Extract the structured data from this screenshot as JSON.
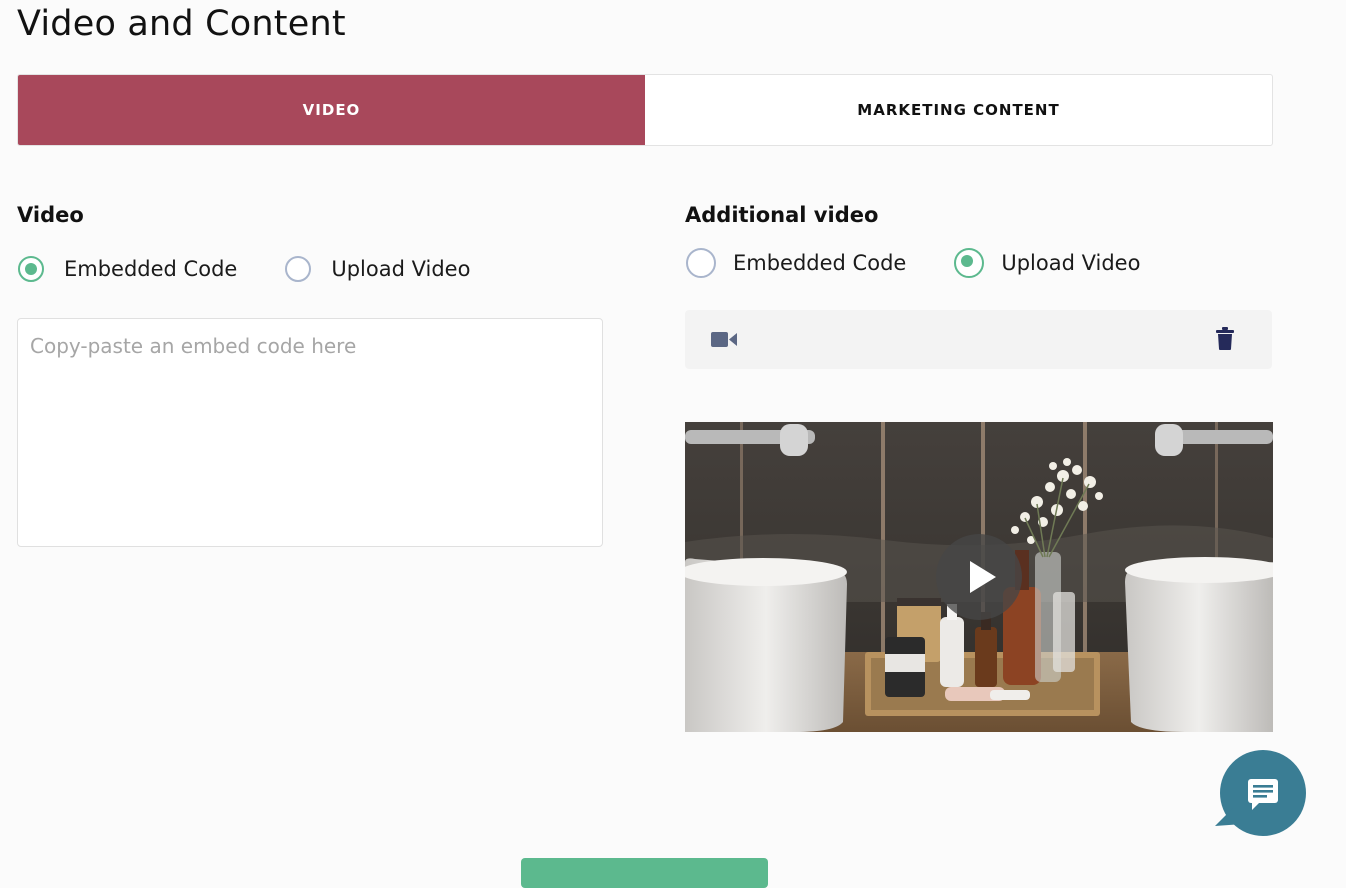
{
  "page": {
    "title": "Video and Content"
  },
  "tabs": [
    {
      "label": "VIDEO",
      "active": true
    },
    {
      "label": "MARKETING CONTENT",
      "active": false
    }
  ],
  "video_section": {
    "title": "Video",
    "options": [
      {
        "label": "Embedded Code",
        "checked": true
      },
      {
        "label": "Upload Video",
        "checked": false
      }
    ],
    "embed_placeholder": "Copy-paste an embed code here",
    "embed_value": ""
  },
  "additional_video_section": {
    "title": "Additional video",
    "options": [
      {
        "label": "Embedded Code",
        "checked": false
      },
      {
        "label": "Upload Video",
        "checked": true
      }
    ],
    "file_icon": "video-camera-icon",
    "delete_icon": "trash-icon",
    "preview_icon": "play-icon"
  },
  "chat": {
    "icon": "chat-bubble-icon"
  },
  "colors": {
    "accent": "#a8485b",
    "radio_checked": "#5cb98e",
    "radio_unchecked": "#a9b5cc",
    "icon_dark": "#252a5a",
    "chat_bg": "#3a7d94",
    "primary_button": "#5cb98e"
  }
}
